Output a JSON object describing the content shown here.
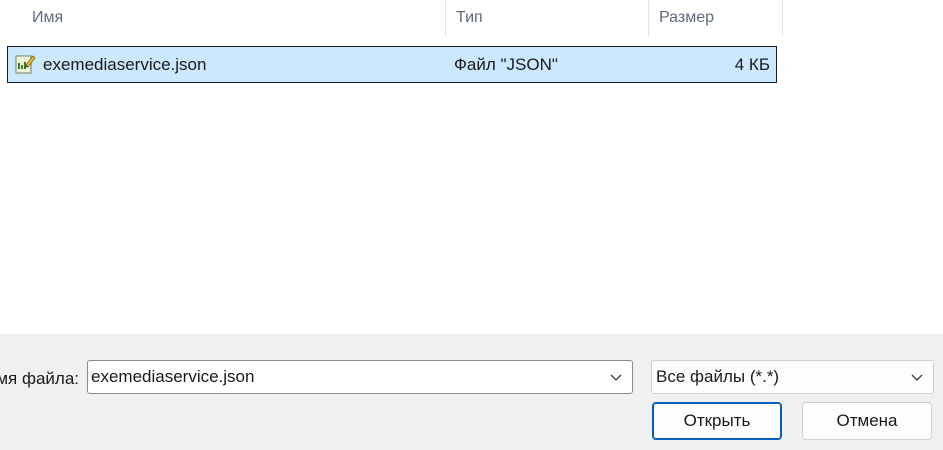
{
  "columns": {
    "name": "Имя",
    "type": "Тип",
    "size": "Размер"
  },
  "files": [
    {
      "name": "exemediaservice.json",
      "type": "Файл \"JSON\"",
      "size": "4 КБ",
      "icon": "json-file-icon",
      "selected": true
    }
  ],
  "footer": {
    "filename_label": "мя файла:",
    "filename_value": "exemediaservice.json",
    "filter_value": "Все файлы (*.*)",
    "open_button": "Открыть",
    "cancel_button": "Отмена"
  },
  "colors": {
    "selection": "#cce8ff",
    "panel": "#f0f0f0",
    "accent": "#005fb8"
  }
}
